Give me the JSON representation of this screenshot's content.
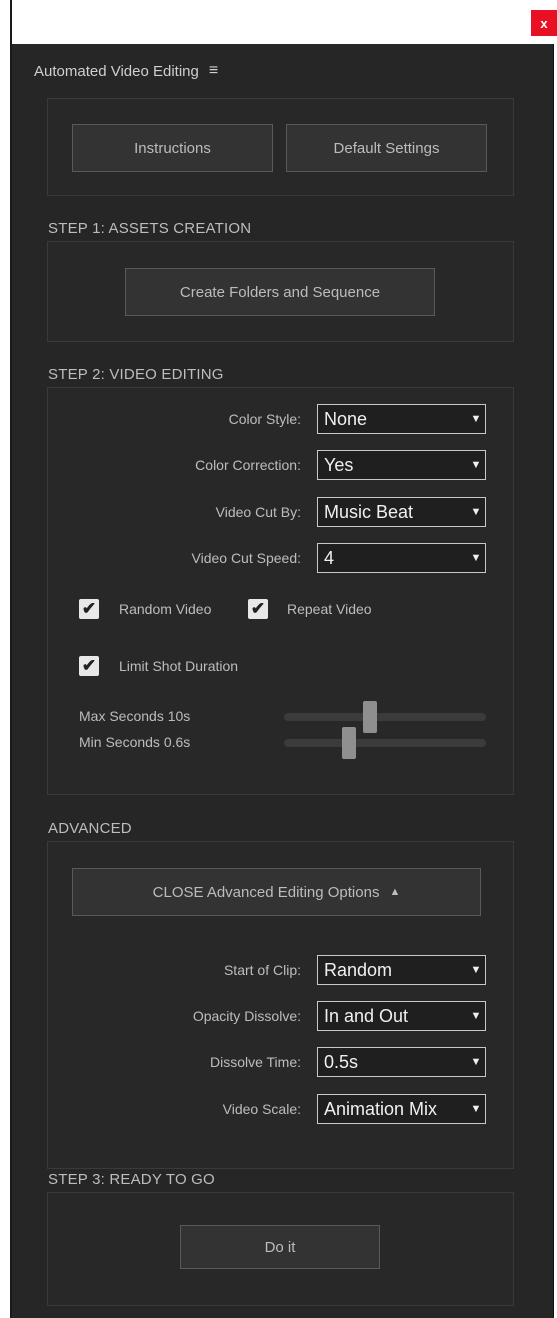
{
  "window": {
    "close_glyph": "x"
  },
  "panel": {
    "title": "Automated Video Editing",
    "menu_icon": "hamburger-icon"
  },
  "top_buttons": {
    "instructions": "Instructions",
    "default_settings": "Default Settings"
  },
  "step1": {
    "title": "STEP 1: ASSETS CREATION",
    "button": "Create Folders and Sequence"
  },
  "step2": {
    "title": "STEP 2: VIDEO EDITING",
    "color_style": {
      "label": "Color Style:",
      "value": "None"
    },
    "color_correction": {
      "label": "Color Correction:",
      "value": "Yes"
    },
    "video_cut_by": {
      "label": "Video Cut By:",
      "value": "Music Beat"
    },
    "video_cut_speed": {
      "label": "Video Cut Speed:",
      "value": "4"
    },
    "random_video": {
      "label": "Random Video",
      "checked": true
    },
    "repeat_video": {
      "label": "Repeat Video",
      "checked": true
    },
    "limit_shot_duration": {
      "label": "Limit Shot Duration",
      "checked": true
    },
    "max_seconds": {
      "label": "Max Seconds 10s",
      "level": 0.42
    },
    "min_seconds": {
      "label": "Min Seconds 0.6s",
      "level": 0.31
    }
  },
  "advanced": {
    "title": "ADVANCED",
    "toggle_button": "CLOSE Advanced Editing Options",
    "toggle_icon": "triangle-up-icon",
    "start_of_clip": {
      "label": "Start of Clip:",
      "value": "Random"
    },
    "opacity_dissolve": {
      "label": "Opacity Dissolve:",
      "value": "In and Out"
    },
    "dissolve_time": {
      "label": "Dissolve Time:",
      "value": "0.5s"
    },
    "video_scale": {
      "label": "Video Scale:",
      "value": "Animation Mix"
    }
  },
  "step3": {
    "title": "STEP 3: READY TO GO",
    "button": "Do it"
  },
  "colors": {
    "panel_bg": "#262626",
    "close_red": "#e81123",
    "text": "#bdbdbd"
  }
}
